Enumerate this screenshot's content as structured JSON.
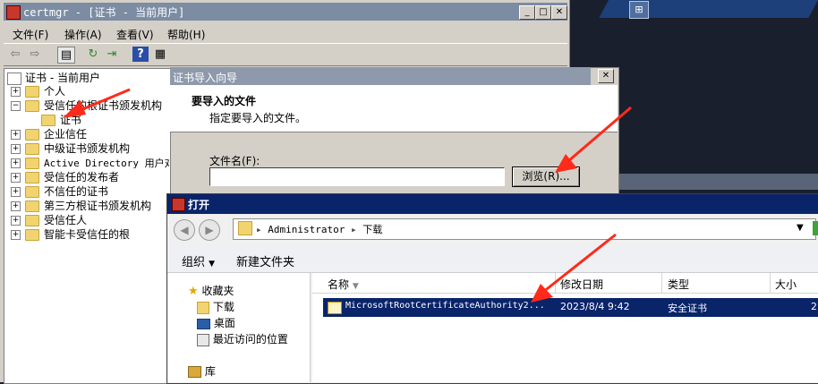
{
  "certmgr": {
    "title": "certmgr - [证书 - 当前用户]",
    "menu": [
      "文件(F)",
      "操作(A)",
      "查看(V)",
      "帮助(H)"
    ],
    "tree": {
      "root": "证书 - 当前用户",
      "items": [
        {
          "label": "个人",
          "expander": "+"
        },
        {
          "label": "受信任的根证书颁发机构",
          "expander": "−"
        },
        {
          "label": "证书",
          "expander": ""
        },
        {
          "label": "企业信任",
          "expander": "+"
        },
        {
          "label": "中级证书颁发机构",
          "expander": "+"
        },
        {
          "label": "Active Directory 用户对象",
          "expander": "+"
        },
        {
          "label": "受信任的发布者",
          "expander": "+"
        },
        {
          "label": "不信任的证书",
          "expander": "+"
        },
        {
          "label": "第三方根证书颁发机构",
          "expander": "+"
        },
        {
          "label": "受信任人",
          "expander": "+"
        },
        {
          "label": "智能卡受信任的根",
          "expander": "+"
        }
      ]
    }
  },
  "wizard": {
    "title": "证书导入向导",
    "heading": "要导入的文件",
    "subheading": "指定要导入的文件。",
    "file_label": "文件名(F):",
    "file_value": "",
    "browse_label": "浏览(R)..."
  },
  "open_dialog": {
    "title": "打开",
    "breadcrumb": [
      "Administrator",
      "下载"
    ],
    "organize_label": "组织",
    "new_folder_label": "新建文件夹",
    "nav": {
      "favorites": "收藏夹",
      "items": [
        "下载",
        "桌面",
        "最近访问的位置"
      ],
      "library": "库"
    },
    "columns": [
      "名称",
      "修改日期",
      "类型",
      "大小"
    ],
    "files": [
      {
        "name": "MicrosoftRootCertificateAuthority2...",
        "date": "2023/8/4 9:42",
        "type": "安全证书",
        "size": "2"
      }
    ]
  },
  "colors": {
    "title_active": "#0a246a",
    "title_inactive": "#7b8ca3",
    "annotation_arrow": "#ff2a1a"
  }
}
